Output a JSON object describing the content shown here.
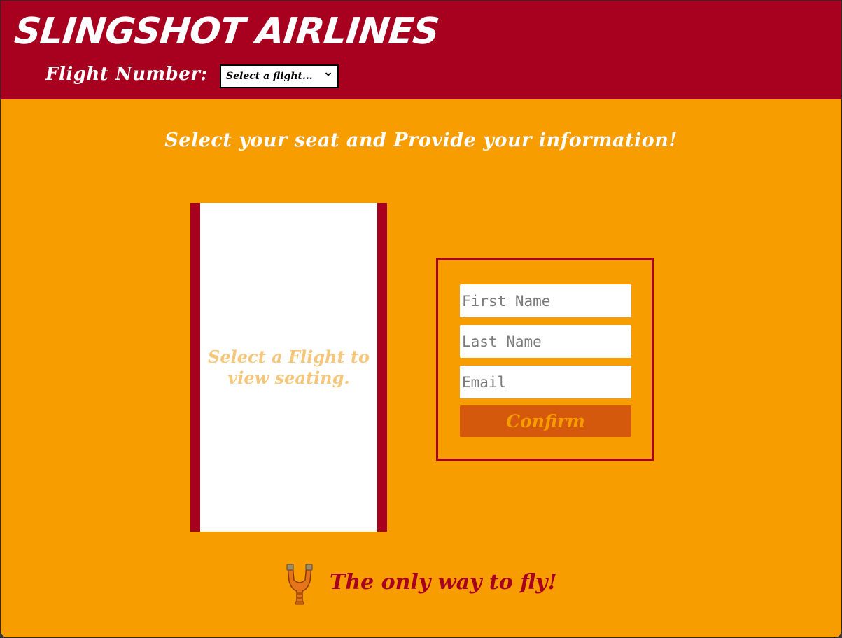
{
  "header": {
    "brand": "SLINGSHOT AIRLINES",
    "flight_label": "Flight Number:",
    "flight_select_value": "Select a flight..."
  },
  "main": {
    "heading": "Select your seat and Provide your information!",
    "seat_message": "Select a Flight to view seating."
  },
  "form": {
    "first_name_placeholder": "First Name",
    "last_name_placeholder": "Last Name",
    "email_placeholder": "Email",
    "confirm_label": "Confirm"
  },
  "footer": {
    "tagline": "The only way to fly!",
    "logo_icon": "slingshot-icon"
  },
  "colors": {
    "header_bg": "#a8001f",
    "page_bg": "#f89d00",
    "confirm_bg": "#d4590c",
    "seat_text": "#f6c77a"
  }
}
